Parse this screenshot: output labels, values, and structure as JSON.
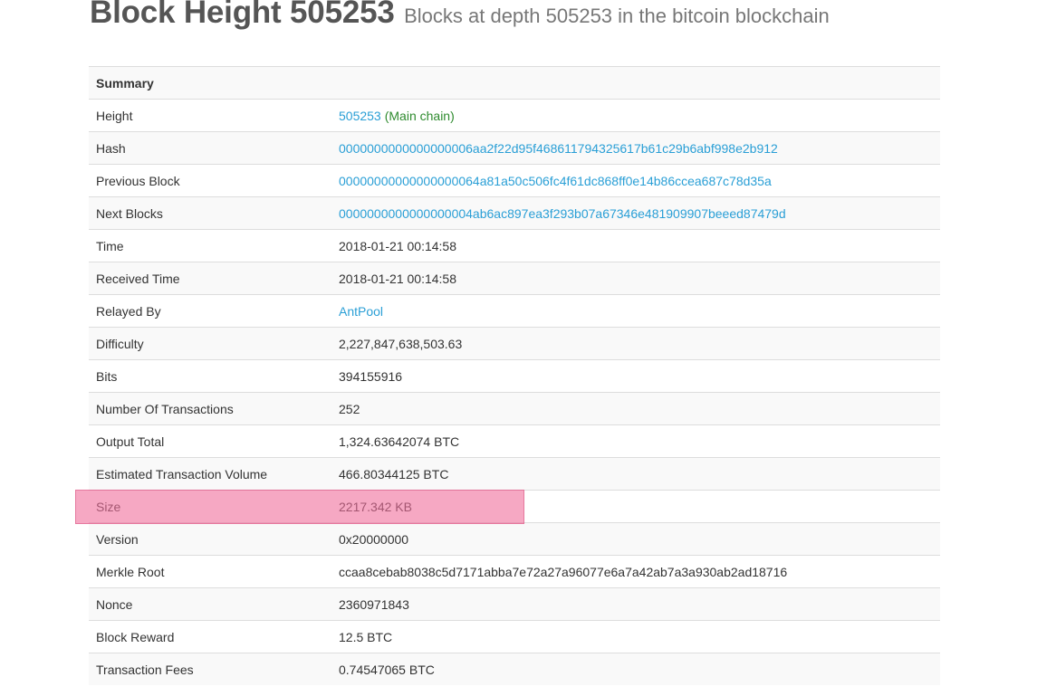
{
  "header": {
    "title": "Block Height 505253",
    "subtitle": "Blocks at depth 505253 in the bitcoin blockchain"
  },
  "summary": {
    "caption": "Summary",
    "height": {
      "label": "Height",
      "value": "505253",
      "note": "(Main chain)"
    },
    "hash": {
      "label": "Hash",
      "value": "0000000000000000006aa2f22d95f468611794325617b61c29b6abf998e2b912"
    },
    "previous_block": {
      "label": "Previous Block",
      "value": "00000000000000000064a81a50c506fc4f61dc868ff0e14b86ccea687c78d35a"
    },
    "next_blocks": {
      "label": "Next Blocks",
      "value": "0000000000000000004ab6ac897ea3f293b07a67346e481909907beeed87479d"
    },
    "time": {
      "label": "Time",
      "value": "2018-01-21 00:14:58"
    },
    "received_time": {
      "label": "Received Time",
      "value": "2018-01-21 00:14:58"
    },
    "relayed_by": {
      "label": "Relayed By",
      "value": "AntPool"
    },
    "difficulty": {
      "label": "Difficulty",
      "value": "2,227,847,638,503.63"
    },
    "bits": {
      "label": "Bits",
      "value": "394155916"
    },
    "num_transactions": {
      "label": "Number Of Transactions",
      "value": "252"
    },
    "output_total": {
      "label": "Output Total",
      "value": "1,324.63642074 BTC"
    },
    "est_tx_volume": {
      "label": "Estimated Transaction Volume",
      "value": "466.80344125 BTC"
    },
    "size": {
      "label": "Size",
      "value": "2217.342 KB"
    },
    "version": {
      "label": "Version",
      "value": "0x20000000"
    },
    "merkle_root": {
      "label": "Merkle Root",
      "value": "ccaa8cebab8038c5d7171abba7e72a27a96077e6a7a42ab7a3a930ab2ad18716"
    },
    "nonce": {
      "label": "Nonce",
      "value": "2360971843"
    },
    "block_reward": {
      "label": "Block Reward",
      "value": "12.5 BTC"
    },
    "transaction_fees": {
      "label": "Transaction Fees",
      "value": "0.74547065 BTC"
    }
  },
  "colors": {
    "link": "#2a9fd6",
    "main_chain": "#2e8b2e",
    "highlight": "#f06e9b"
  }
}
